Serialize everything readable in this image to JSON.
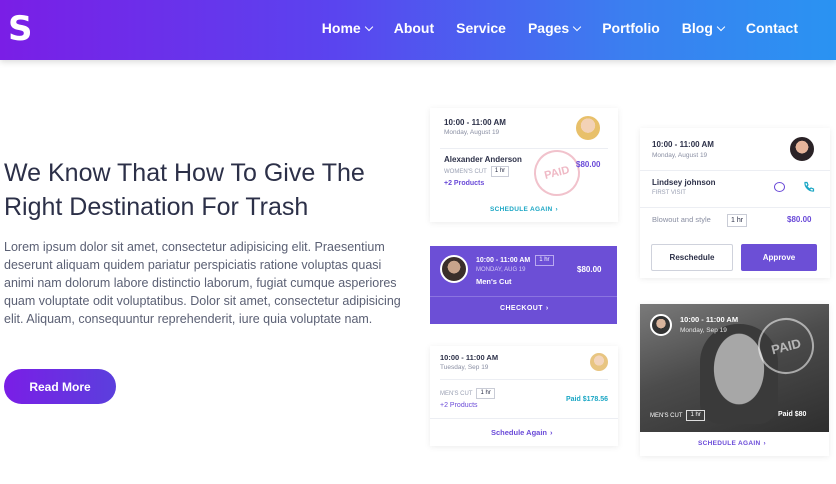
{
  "header": {
    "logo": "S",
    "nav": [
      {
        "label": "Home",
        "has_dropdown": true
      },
      {
        "label": "About",
        "has_dropdown": false
      },
      {
        "label": "Service",
        "has_dropdown": false
      },
      {
        "label": "Pages",
        "has_dropdown": true
      },
      {
        "label": "Portfolio",
        "has_dropdown": false
      },
      {
        "label": "Blog",
        "has_dropdown": true
      },
      {
        "label": "Contact",
        "has_dropdown": false
      }
    ]
  },
  "hero": {
    "headline": "We Know That How To Give The Right Destination For Trash",
    "body": "Lorem ipsum dolor sit amet, consectetur adipisicing elit. Praesentium deserunt aliquam quidem pariatur perspiciatis ratione voluptas quasi animi nam dolorum labore distinctio laborum, fugiat cumque asperiores quam voluptate odit voluptatibus. Dolor sit amet, consectetur adipisicing elit. Aliquam, consequuntur reprehenderit, iure quia voluptate nam.",
    "button": "Read More"
  },
  "cards": {
    "card1": {
      "time": "10:00 - 11:00 AM",
      "date": "Monday, August 19",
      "name": "Alexander Anderson",
      "service": "WOMEN'S CUT",
      "duration": "1 hr",
      "price": "$80.00",
      "products": "+2 Products",
      "stamp": "PAID",
      "action": "SCHEDULE AGAIN"
    },
    "card2": {
      "time": "10:00 - 11:00 AM",
      "duration": "1 hr",
      "date": "MONDAY, AUG 19",
      "service": "Men's Cut",
      "price": "$80.00",
      "action": "CHECKOUT"
    },
    "card3": {
      "time": "10:00 - 11:00 AM",
      "date": "Tuesday, Sep 19",
      "service": "MEN'S CUT",
      "duration": "1 hr",
      "products": "+2 Products",
      "paid": "Paid $178.56",
      "action": "Schedule Again"
    },
    "card4": {
      "time": "10:00 - 11:00 AM",
      "date": "Monday, August 19",
      "name": "Lindsey johnson",
      "visit": "FIRST VISIT",
      "service": "Blowout and style",
      "duration": "1 hr",
      "price": "$80.00",
      "reschedule": "Reschedule",
      "approve": "Approve"
    },
    "card5": {
      "time": "10:00 - 11:00 AM",
      "date": "Monday, Sep 19",
      "stamp": "PAID",
      "service": "MEN'S CUT",
      "duration": "1 hr",
      "paid": "Paid $80",
      "action": "SCHEDULE AGAIN"
    }
  },
  "colors": {
    "brand_purple": "#6a4ad8",
    "teal": "#1aa6c4",
    "heading": "#2c3048"
  }
}
